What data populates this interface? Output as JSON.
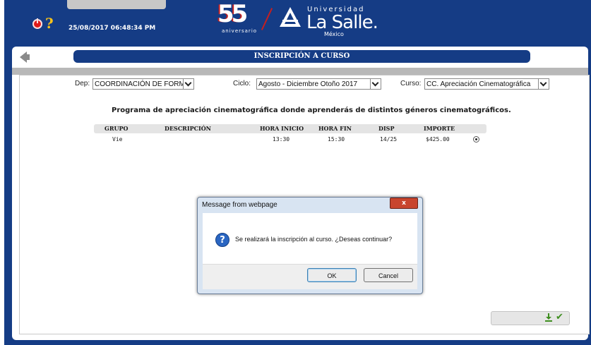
{
  "header": {
    "datetime": "25/08/2017 06:48:34 PM",
    "logo_number": "55",
    "logo_subtext": "aniversario",
    "brand_top": "Universidad",
    "brand_name": "La Salle.",
    "brand_country": "México"
  },
  "page": {
    "title": "INSCRIPCIÓN A CURSO"
  },
  "filters": {
    "dep_label": "Dep:",
    "dep_value": "COORDINACIÓN DE FORMACI",
    "ciclo_label": "Ciclo:",
    "ciclo_value": "Agosto - Diciembre Otoño 2017",
    "curso_label": "Curso:",
    "curso_value": "CC. Apreciación Cinematográfica"
  },
  "program": {
    "description": "Programa de apreciación cinematográfica donde aprenderás de distintos géneros cinematográficos."
  },
  "table": {
    "headers": [
      "GRUPO",
      "DESCRIPCIÓN",
      "HORA INICIO",
      "HORA FIN",
      "DISP",
      "IMPORTE"
    ],
    "rows": [
      {
        "grupo": "Vie",
        "descripcion": "",
        "hora_inicio": "13:30",
        "hora_fin": "15:30",
        "disp": "14/25",
        "importe": "$425.00"
      }
    ]
  },
  "dialog": {
    "title": "Message from webpage",
    "close": "x",
    "message": "Se realizará la inscripción al curso. ¿Deseas continuar?",
    "ok_label": "OK",
    "cancel_label": "Cancel"
  },
  "colors": {
    "brand_blue": "#153c85",
    "accent_red": "#c51f1f",
    "help_yellow": "#f7c21a"
  },
  "icons": [
    "power-icon",
    "help-icon",
    "back-arrow-icon",
    "question-icon",
    "download-icon",
    "check-icon"
  ]
}
